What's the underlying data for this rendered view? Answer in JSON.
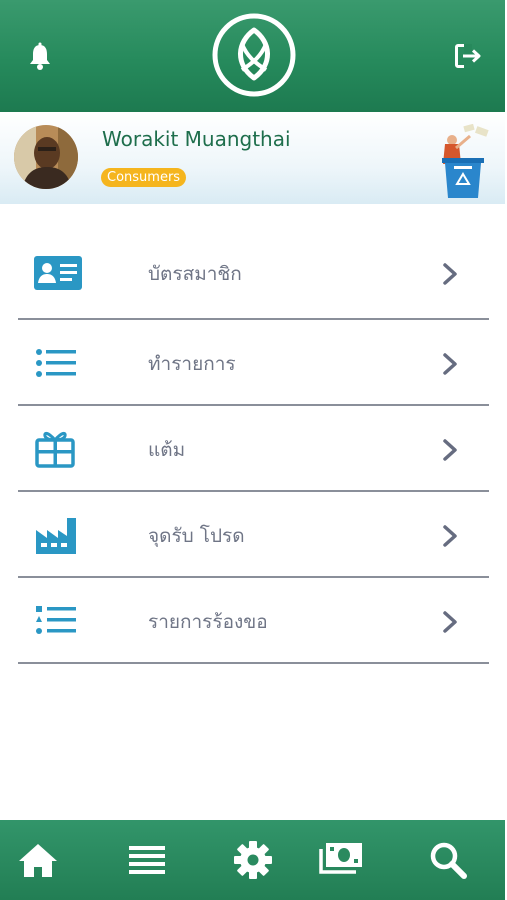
{
  "header": {
    "bell_icon": "bell-icon",
    "logo_icon": "leaf-logo-icon",
    "logout_icon": "logout-icon"
  },
  "profile": {
    "name": "Worakit Muangthai",
    "role_badge": "Consumers",
    "illustration": "recycle-bin-illustration"
  },
  "menu": {
    "items": [
      {
        "label": "บัตรสมาชิก",
        "icon": "member-card-icon"
      },
      {
        "label": "ทำรายการ",
        "icon": "list-icon"
      },
      {
        "label": "แต้ม",
        "icon": "gift-icon"
      },
      {
        "label": "จุดรับ โปรด",
        "icon": "factory-icon"
      },
      {
        "label": "รายการร้องขอ",
        "icon": "request-list-icon"
      }
    ]
  },
  "tabbar": {
    "items": [
      "home-icon",
      "menu-icon",
      "settings-icon",
      "money-icon",
      "search-icon"
    ]
  },
  "colors": {
    "primary_green": "#268a5c",
    "icon_blue": "#2a97c4",
    "badge_orange": "#f5b51e",
    "label_gray": "#6f7586"
  }
}
